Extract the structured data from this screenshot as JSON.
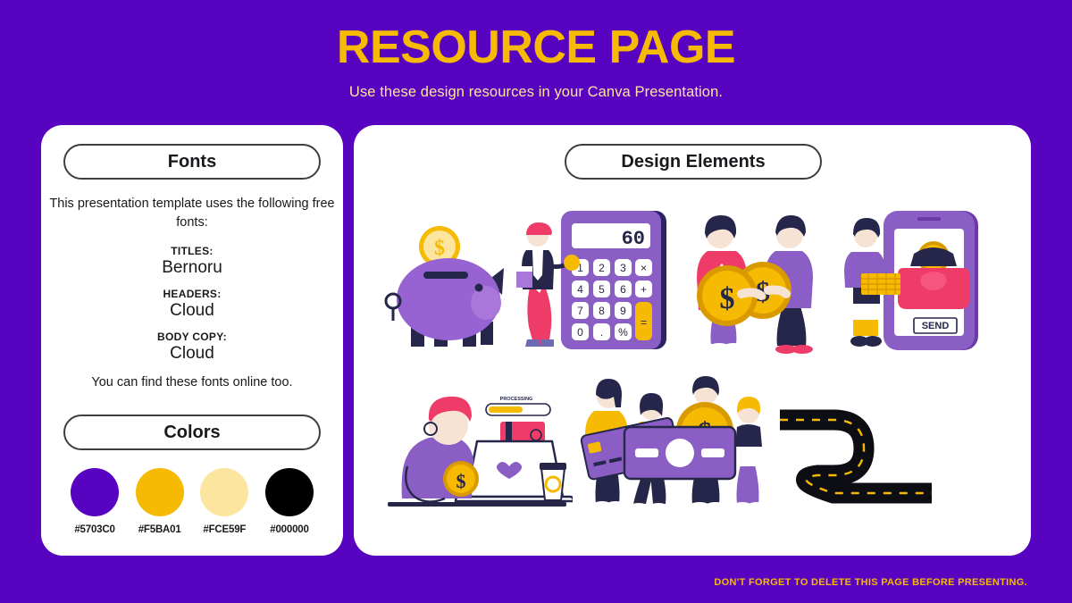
{
  "header": {
    "title": "RESOURCE PAGE",
    "subtitle": "Use these design resources in your Canva Presentation."
  },
  "fonts_panel": {
    "heading": "Fonts",
    "intro": "This presentation template uses the following free fonts:",
    "entries": [
      {
        "label": "TITLES:",
        "value": "Bernoru"
      },
      {
        "label": "HEADERS:",
        "value": "Cloud"
      },
      {
        "label": "BODY COPY:",
        "value": "Cloud"
      }
    ],
    "outro": "You can find these fonts online too."
  },
  "colors_panel": {
    "heading": "Colors",
    "swatches": [
      {
        "hex": "#5703C0",
        "label": "#5703C0"
      },
      {
        "hex": "#F5BA01",
        "label": "#F5BA01"
      },
      {
        "hex": "#FCE59F",
        "label": "#FCE59F"
      },
      {
        "hex": "#000000",
        "label": "#000000"
      }
    ]
  },
  "design_panel": {
    "heading": "Design Elements",
    "illustrations": [
      {
        "name": "piggy-bank-with-coin",
        "alt": "Purple piggy bank with gold dollar coin"
      },
      {
        "name": "calculator-with-person",
        "alt": "Person beside large purple calculator",
        "display": "60"
      },
      {
        "name": "two-people-holding-coins",
        "alt": "Two people holding large gold dollar coins"
      },
      {
        "name": "mobile-payment-purse",
        "alt": "Person beside phone showing pink purse",
        "button": "SEND"
      },
      {
        "name": "person-at-laptop",
        "alt": "Person at laptop with coins and progress bar",
        "status": "PROCESSING"
      },
      {
        "name": "group-holding-credit-card",
        "alt": "Four people carrying a large purple credit card and gold coin"
      },
      {
        "name": "winding-road",
        "alt": "Winding black road with yellow dashed line"
      }
    ]
  },
  "footer": {
    "note": "DON'T FORGET TO DELETE THIS PAGE BEFORE PRESENTING."
  },
  "theme": {
    "background": "#5703C0",
    "accent_yellow": "#F5BA01",
    "accent_cream": "#FCE59F",
    "ink": "#000000",
    "card": "#FFFFFF"
  }
}
